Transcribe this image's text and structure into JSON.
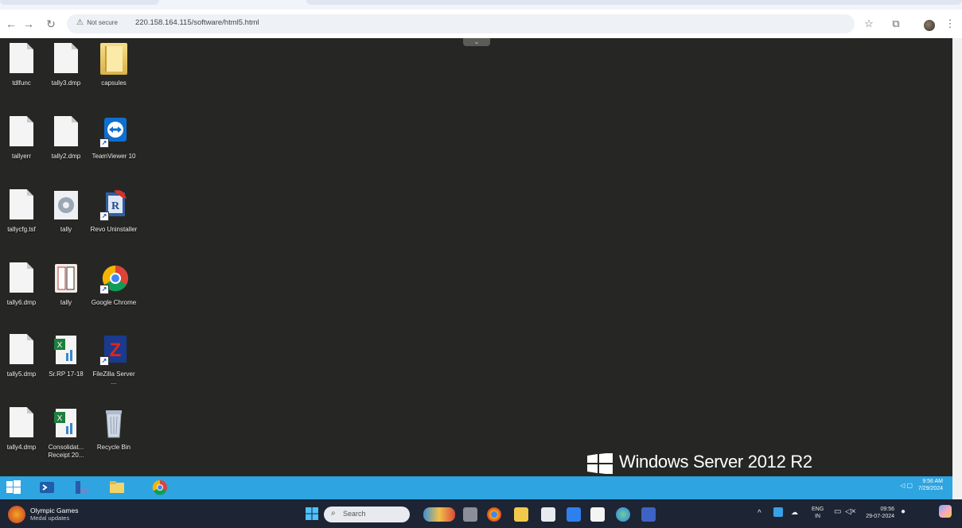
{
  "browser": {
    "security_label": "Not secure",
    "url": "220.158.164.115/software/html5.html",
    "icons": [
      "back-icon",
      "forward-icon",
      "reload-icon",
      "warning-icon",
      "star-icon",
      "extensions-icon",
      "profile-avatar",
      "menu-icon"
    ]
  },
  "desktop": {
    "icons": [
      {
        "label": "tdlfunc",
        "type": "document"
      },
      {
        "label": "tally3.dmp",
        "type": "document"
      },
      {
        "label": "capsules",
        "type": "folder"
      },
      {
        "label": "tallyerr",
        "type": "document"
      },
      {
        "label": "tally2.dmp",
        "type": "document"
      },
      {
        "label": "TeamViewer 10",
        "type": "app"
      },
      {
        "label": "tallycfg.tsf",
        "type": "document"
      },
      {
        "label": "tally",
        "type": "app"
      },
      {
        "label": "Revo Uninstaller",
        "type": "app"
      },
      {
        "label": "tally6.dmp",
        "type": "document"
      },
      {
        "label": "tally",
        "type": "app"
      },
      {
        "label": "Google Chrome",
        "type": "app"
      },
      {
        "label": "tally5.dmp",
        "type": "document"
      },
      {
        "label": "Sr.RP 17-18",
        "type": "spreadsheet"
      },
      {
        "label": "FileZilla Server ...",
        "type": "app"
      },
      {
        "label": "tally4.dmp",
        "type": "document"
      },
      {
        "label": "Consolidat... Receipt 20...",
        "type": "spreadsheet"
      },
      {
        "label": "Recycle Bin",
        "type": "app"
      }
    ],
    "watermark": "Windows Server 2012 R2"
  },
  "server_taskbar": {
    "clock_time": "9:56 AM",
    "clock_date": "7/29/2024"
  },
  "host_taskbar": {
    "news_title": "Olympic Games",
    "news_subtitle": "Medal updates",
    "search_placeholder": "Search",
    "lang": "ENG",
    "region": "IN",
    "clock_time": "09:56",
    "clock_date": "29-07-2024"
  },
  "colors": {
    "desktop_bg": "#262724",
    "server_taskbar": "#2ea4e0",
    "host_taskbar": "#1d2433"
  }
}
